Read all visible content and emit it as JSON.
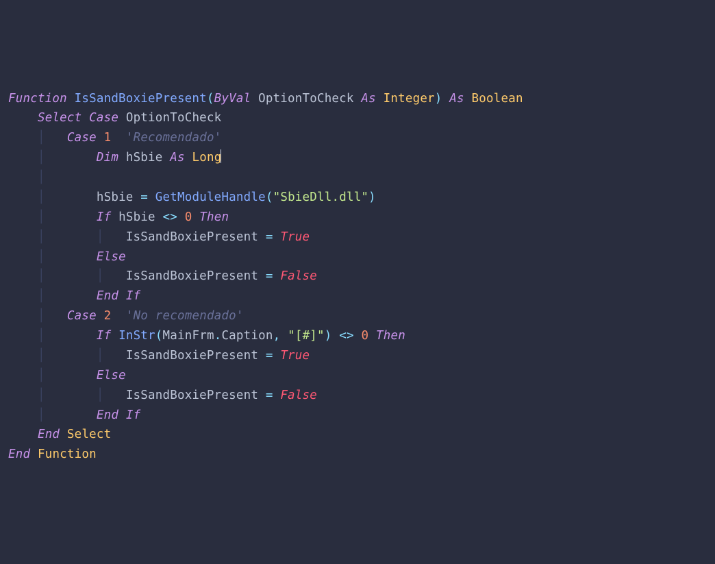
{
  "code": {
    "l1": {
      "kw_function": "Function",
      "name": "IsSandBoxiePresent",
      "lp": "(",
      "byval": "ByVal",
      "param": "OptionToCheck",
      "as1": "As",
      "t1": "Integer",
      "rp": ")",
      "as2": "As",
      "t2": "Boolean"
    },
    "l2": {
      "kw_select": "Select",
      "kw_case": "Case",
      "expr": "OptionToCheck"
    },
    "l3": {
      "kw_case": "Case",
      "num": "1",
      "cmt": "'Recomendado'"
    },
    "l4": {
      "kw_dim": "Dim",
      "var": "hSbie",
      "as": "As",
      "t": "Long"
    },
    "l6": {
      "lhs": "hSbie",
      "eq": "=",
      "fn": "GetModuleHandle",
      "lp": "(",
      "str": "\"SbieDll.dll\"",
      "rp": ")"
    },
    "l7": {
      "kw_if": "If",
      "var": "hSbie",
      "op": "<>",
      "num": "0",
      "kw_then": "Then"
    },
    "l8": {
      "lhs": "IsSandBoxiePresent",
      "eq": "=",
      "val": "True"
    },
    "l9": {
      "kw_else": "Else"
    },
    "l10": {
      "lhs": "IsSandBoxiePresent",
      "eq": "=",
      "val": "False"
    },
    "l11": {
      "kw_end": "End",
      "kw_if": "If"
    },
    "l12": {
      "kw_case": "Case",
      "num": "2",
      "cmt": "'No recomendado'"
    },
    "l13": {
      "kw_if": "If",
      "fn": "InStr",
      "lp": "(",
      "arg1": "MainFrm",
      "dot": ".",
      "arg2": "Caption",
      "comma": ",",
      "str": "\"[#]\"",
      "rp": ")",
      "op": "<>",
      "num": "0",
      "kw_then": "Then"
    },
    "l14": {
      "lhs": "IsSandBoxiePresent",
      "eq": "=",
      "val": "True"
    },
    "l15": {
      "kw_else": "Else"
    },
    "l16": {
      "lhs": "IsSandBoxiePresent",
      "eq": "=",
      "val": "False"
    },
    "l17": {
      "kw_end": "End",
      "kw_if": "If"
    },
    "l18": {
      "kw_end": "End",
      "kw_select": "Select"
    },
    "l19": {
      "kw_end": "End",
      "kw_function": "Function"
    }
  },
  "indent": {
    "g": "│   ",
    "s": "    "
  }
}
